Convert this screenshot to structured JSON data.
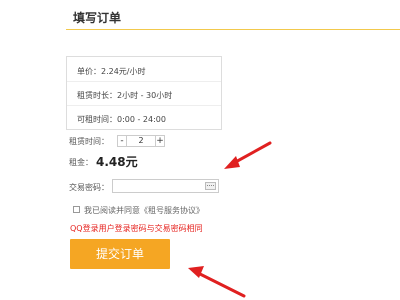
{
  "header": {
    "title": "填写订单"
  },
  "info": {
    "unit_price": "单价：2.24元/小时",
    "rent_duration": "租赁时长：2小时 - 30小时",
    "rent_time": "可租时间：0:00 - 24:00"
  },
  "form": {
    "rent_time_label": "租赁时间：",
    "stepper_minus": "-",
    "stepper_value": "2",
    "stepper_plus": "+",
    "rent_label": "租金：",
    "rent_amount": "4.48元",
    "password_label": "交易密码：",
    "password_value": "",
    "agree_text": "我已阅读并同意《租号服务协议》",
    "warning": "QQ登录用户登录密码与交易密码相同",
    "submit_label": "提交订单"
  },
  "icons": {
    "keyboard": "keyboard-icon",
    "arrows": "red-arrow-icon"
  },
  "colors": {
    "accent": "#f5a623",
    "divider": "#f2c94c",
    "warning": "#e6231f",
    "arrow": "#e02020"
  }
}
